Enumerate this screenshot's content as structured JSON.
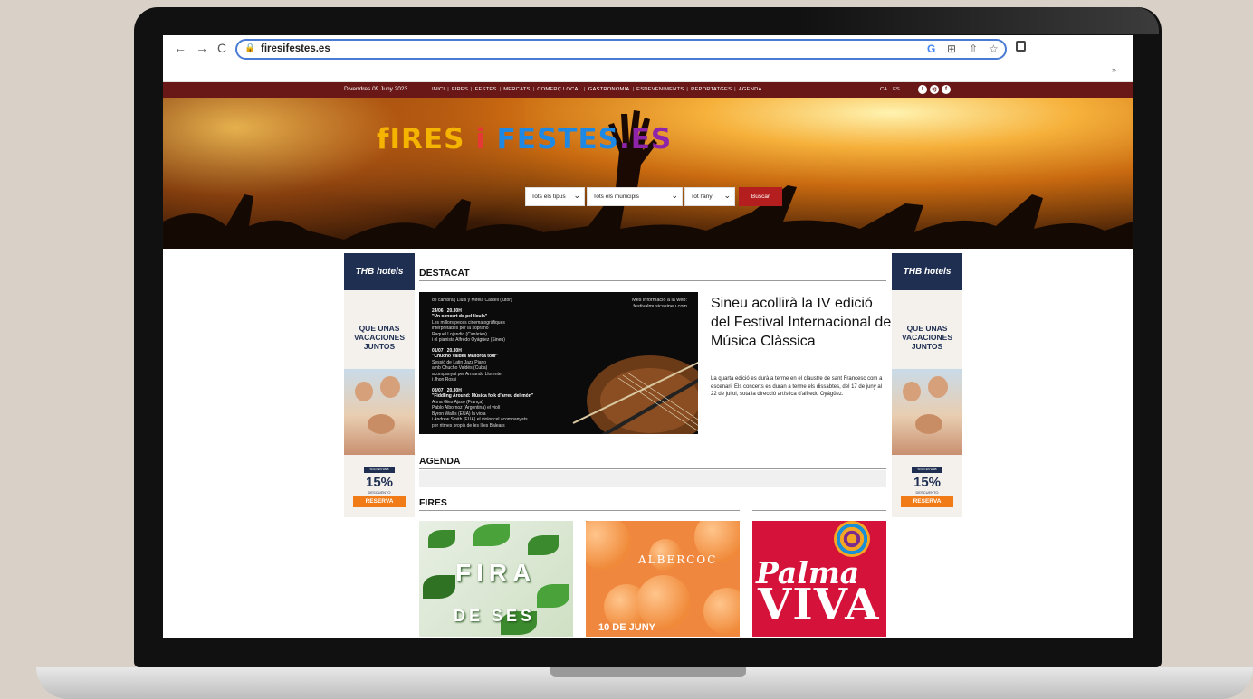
{
  "browser": {
    "url": "firesifestes.es",
    "nav": [
      "←",
      "→",
      "C"
    ],
    "icons": [
      "G",
      "⊞",
      "⇧",
      "☆"
    ],
    "more": "»"
  },
  "topbar": {
    "date": "Divendres 09 Juny 2023",
    "menu": [
      "INICI",
      "FIRES",
      "FESTES",
      "MERCATS",
      "COMERÇ LOCAL",
      "GASTRONOMIA",
      "ESDEVENIMENTS",
      "REPORTATGES",
      "AGENDA"
    ],
    "lang": [
      "CA",
      "ES"
    ],
    "social": [
      "t",
      "ig",
      "f"
    ]
  },
  "hero": {
    "logo": {
      "p1": "fIRES",
      "p2": " i ",
      "p3": "FESTES",
      "p4": ".ES"
    },
    "filters": {
      "tipus": "Tots els tipus",
      "municipi": "Tots els municipis",
      "any": "Tot l'any",
      "buscar": "Buscar"
    }
  },
  "ad": {
    "brand": "THB hotels",
    "slogan": [
      "QUE UNAS",
      "VACACIONES",
      "JUNTOS"
    ],
    "tag": "SOLO EN WEB",
    "percent": "15%",
    "descuento": "DESCUENTO",
    "reserva": "RESERVA"
  },
  "main": {
    "destacat_title": "DESTACAT",
    "featured": {
      "title": "Sineu acollirà la IV edició del Festival Internacional de Música Clàssica",
      "body": "La quarta edició es durà a terme en el claustre de sant Francesc com a escenari. Els concerts es duran a terme els dissabtes, del 17 de juny al 22 de juliol, sota la direcció artística d'alfredo Oyágüez.",
      "poster_site": "festivalmusicasineu.com",
      "poster_site_top": "Més informació a la web:",
      "poster_lines": [
        "de cambra | Lluís y Mireia Castell (tutor)",
        "24/06 | 20.30H",
        "\"Un concert de pel·lícula\"",
        "Les millors peces cinematogràfiques",
        "interpretades per la soprano",
        "Raquel Lojendio (Canàries)",
        "i el pianista Alfredo Oyágüez (Sineu)",
        "01/07 | 20.30H",
        "\"Chucho Valdés Mallorca tour\"",
        "Sessió de Latin Jazz Piano",
        "amb Chucho Valdés (Cuba)",
        "acompanyat per Armando Llorente",
        "i Jhon Rossi",
        "08/07 | 20.30H",
        "\"Fiddling Around: Música folk d'arreu del món\"",
        "Anna Gies Ajsso (França)",
        "Pablo Albornoz (Argentina) el violí",
        "Byron Wallis (EUA) la viola",
        "i Andrew Smith (EUA) el violoncel acompanyats",
        "per ritmes propis de les Illes Balears"
      ]
    },
    "agenda_title": "AGENDA",
    "fires_title": "FIRES",
    "cards": {
      "c1_big": "FIRA",
      "c1_small": "DE SES",
      "c2_top": "ALBERCOC",
      "c2_bottom": "10 DE JUNY",
      "c3_top": "Palma",
      "c3_bottom": "VIVA"
    }
  }
}
